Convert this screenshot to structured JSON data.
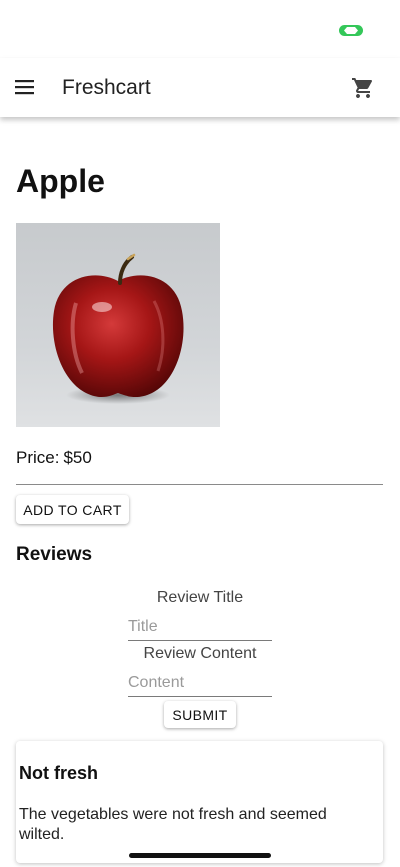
{
  "app_bar": {
    "title": "Freshcart",
    "menu_icon": "hamburger-menu-icon",
    "cart_icon": "shopping-cart-icon"
  },
  "product": {
    "name": "Apple",
    "image_icon": "apple-photo",
    "price_label": "Price:",
    "price_value": "$50",
    "add_to_cart_label": "ADD TO CART"
  },
  "reviews": {
    "heading": "Reviews",
    "form": {
      "title_label": "Review Title",
      "title_placeholder": "Title",
      "title_value": "",
      "content_label": "Review Content",
      "content_placeholder": "Content",
      "content_value": "",
      "submit_label": "SUBMIT"
    },
    "items": [
      {
        "title": "Not fresh",
        "content": "The vegetables were not fresh and seemed wilted."
      }
    ]
  },
  "colors": {
    "status_indicator": "#34c759",
    "text": "#111111",
    "divider": "#8a8a8a"
  }
}
